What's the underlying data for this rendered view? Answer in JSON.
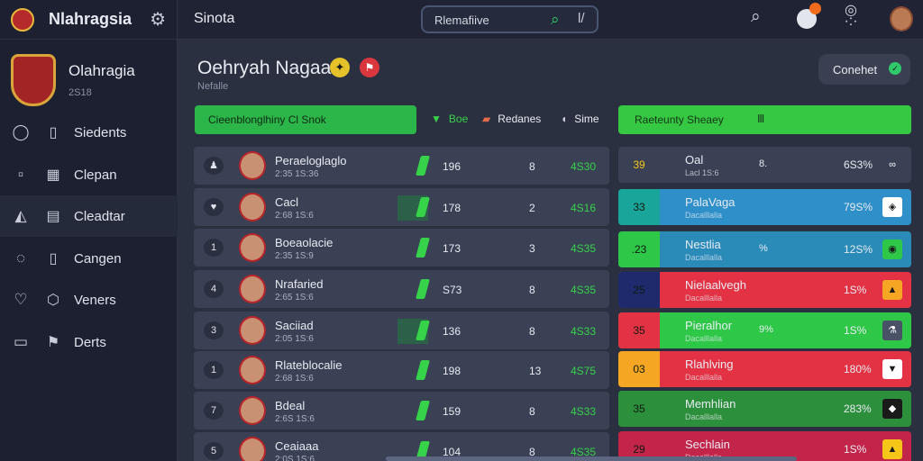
{
  "sidebar": {
    "app_title": "Nlahragsia",
    "brand_name": "Olahragia",
    "brand_sub": "2S18",
    "items": [
      {
        "label": "Siedents",
        "icon": "whatsapp-icon",
        "icon2": "file-icon"
      },
      {
        "label": "Clepan",
        "icon": "square-icon",
        "icon2": "chart-icon"
      },
      {
        "label": "Cleadtar",
        "icon": "triangle-icon",
        "icon2": "calendar-icon"
      },
      {
        "label": "Cangen",
        "icon": "globe-icon",
        "icon2": "file-icon"
      },
      {
        "label": "Veners",
        "icon": "heart-icon",
        "icon2": "cube-icon"
      },
      {
        "label": "Derts",
        "icon": "square-icon",
        "icon2": "flag-icon"
      }
    ]
  },
  "topbar": {
    "title": "Sinota",
    "search_value": "Rlemafiive",
    "search_sep": "l/"
  },
  "header": {
    "title": "Oehryah Nagaa",
    "sub": "Nefalle",
    "connect_label": "Conehet"
  },
  "filters": {
    "green_label": "Cieenblonglhiny  Cl Snok",
    "f1": "Boe",
    "f2": "Redanes",
    "f3": "Sime",
    "green2_label": "Raeteunty   Sheaey",
    "green2_icon": "Ⅲ"
  },
  "rows": [
    {
      "icon": "♟",
      "name": "Peraeloglaglo",
      "sub": "2:35 1S:36",
      "n1": "196",
      "n2": "8",
      "n3": "4S30",
      "shade": false
    },
    {
      "icon": "♥",
      "name": "Cacl",
      "sub": "2:68 1S:6",
      "n1": "178",
      "n2": "2",
      "n3": "4S16",
      "shade": true
    },
    {
      "icon": "1",
      "name": "Boeaolacie",
      "sub": "2:35 1S:9",
      "n1": "173",
      "n2": "3",
      "n3": "4S35",
      "shade": false
    },
    {
      "icon": "4",
      "name": "Nrafaried",
      "sub": "2:65 1S:6",
      "n1": "S73",
      "n2": "8",
      "n3": "4S35",
      "shade": false
    },
    {
      "icon": "3",
      "name": "Saciiad",
      "sub": "2:05 1S:6",
      "n1": "136",
      "n2": "8",
      "n3": "4S33",
      "shade": true
    },
    {
      "icon": "1",
      "name": "Rlateblocalie",
      "sub": "2:68 1S:6",
      "n1": "198",
      "n2": "13",
      "n3": "4S75",
      "shade": false
    },
    {
      "icon": "7",
      "name": "Bdeal",
      "sub": "2:6S 1S:6",
      "n1": "159",
      "n2": "8",
      "n3": "4S33",
      "shade": false
    },
    {
      "icon": "5",
      "name": "Ceaiaaa",
      "sub": "2:0S 1S:6",
      "n1": "104",
      "n2": "8",
      "n3": "4S35",
      "shade": false
    }
  ],
  "rank_rows": [
    {
      "num": "39",
      "name": "Oal",
      "sub": "Lacl 1S:6",
      "mid": "8.",
      "pct": "6S3%",
      "icon": "∞"
    },
    {
      "num": "33",
      "name": "PalaVaga",
      "sub": "Dacalllalla",
      "mid": "",
      "pct": "79S%",
      "icon": "◈"
    },
    {
      "num": ".23",
      "name": "Nestlia",
      "sub": "Dacalllalla",
      "mid": "%",
      "pct": "12S%",
      "icon": "◉"
    },
    {
      "num": "25",
      "name": "Nielaalvegh",
      "sub": "Dacalllalla",
      "mid": "",
      "pct": "1S%",
      "icon": "▲"
    },
    {
      "num": "35",
      "name": "Pieralhor",
      "sub": "Dacalllalla",
      "mid": "9%",
      "pct": "1S%",
      "icon": "⚗"
    },
    {
      "num": "03",
      "name": "Rlahlving",
      "sub": "Dacalllalla",
      "mid": "",
      "pct": "180%",
      "icon": "▼"
    },
    {
      "num": "35",
      "name": "Memhlian",
      "sub": "Dacalllalla",
      "mid": "",
      "pct": "283%",
      "icon": "◆"
    },
    {
      "num": "29",
      "name": "Sechlain",
      "sub": "Dacalllalla",
      "mid": "",
      "pct": "1S%",
      "icon": "▲"
    }
  ],
  "colors": {
    "bg": "#2b3040",
    "sidebar": "#1c2030",
    "accent_green": "#36d34a",
    "rank_rows": [
      {
        "num_bg": "#3a4154",
        "body": "#3a4154",
        "icon_bg": "#3a4154"
      },
      {
        "num_bg": "#19a59a",
        "body": "#2f8fc9",
        "icon_bg": "#ffffff"
      },
      {
        "num_bg": "#2ec748",
        "body": "#2a8bb8",
        "icon_bg": "#2ec748"
      },
      {
        "num_bg": "#1e2a6b",
        "body": "#e23243",
        "icon_bg": "#f5a623"
      },
      {
        "num_bg": "#e23243",
        "body": "#2ec748",
        "icon_bg": "#4a5268"
      },
      {
        "num_bg": "#f5a623",
        "body": "#e23243",
        "icon_bg": "#ffffff"
      },
      {
        "num_bg": "#2c8f3c",
        "body": "#2c8f3c",
        "icon_bg": "#1a1a1a"
      },
      {
        "num_bg": "#c3244a",
        "body": "#c3244a",
        "icon_bg": "#f5c518"
      }
    ]
  }
}
